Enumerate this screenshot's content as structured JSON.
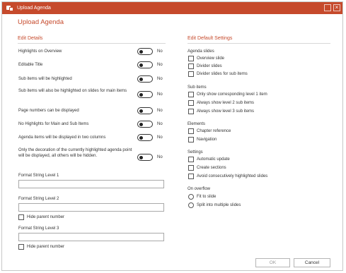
{
  "window": {
    "title": "Upload Agenda"
  },
  "page_heading": "Upload Agenda",
  "left": {
    "section_title": "Edit Details",
    "toggles": [
      {
        "label": "Highlights on Overview",
        "state": "No"
      },
      {
        "label": "Editable Title",
        "state": "No"
      },
      {
        "label": "Sub items will be highlighted",
        "state": "No"
      },
      {
        "label": "Sub items will also be highlighted on slides for main items",
        "state": "No"
      },
      {
        "label": "Page numbers can be displayed",
        "state": "No"
      },
      {
        "label": "No Highlights for Main and Sub Items",
        "state": "No"
      },
      {
        "label": "Agenda items will be displayed in two columns",
        "state": "No"
      },
      {
        "label": "Only the decoration of the currently highlighted agenda point will be displayed, all others will be hidden.",
        "state": "No"
      }
    ],
    "format1": {
      "label": "Format String Level 1",
      "value": ""
    },
    "format2": {
      "label": "Format String Level 2",
      "value": "",
      "hide_parent": "Hide parent number"
    },
    "format3": {
      "label": "Format String Level 3",
      "value": "",
      "hide_parent": "Hide parent number"
    }
  },
  "right": {
    "section_title": "Edit Default Settings",
    "agenda_slides": {
      "title": "Agenda slides",
      "options": [
        "Overview slide",
        "Divider slides",
        "Divider slides for sub items"
      ]
    },
    "sub_items": {
      "title": "Sub items",
      "options": [
        "Only show corresponding level 1 item",
        "Always show level 2 sub items",
        "Always show level 3 sub items"
      ]
    },
    "elements": {
      "title": "Elements",
      "options": [
        "Chapter reference",
        "Navigation"
      ]
    },
    "settings": {
      "title": "Settings",
      "options": [
        "Automatic update",
        "Create sections",
        "Avoid consecutively highlighted slides"
      ]
    },
    "on_overflow": {
      "title": "On overflow",
      "options": [
        "Fit to slide",
        "Split into multiple slides"
      ]
    }
  },
  "buttons": {
    "ok": "OK",
    "cancel": "Cancel"
  },
  "colors": {
    "accent": "#c64a2c"
  },
  "icons": {
    "app": "agenda-app-icon",
    "maximize": "maximize-icon",
    "close": "close-icon"
  }
}
